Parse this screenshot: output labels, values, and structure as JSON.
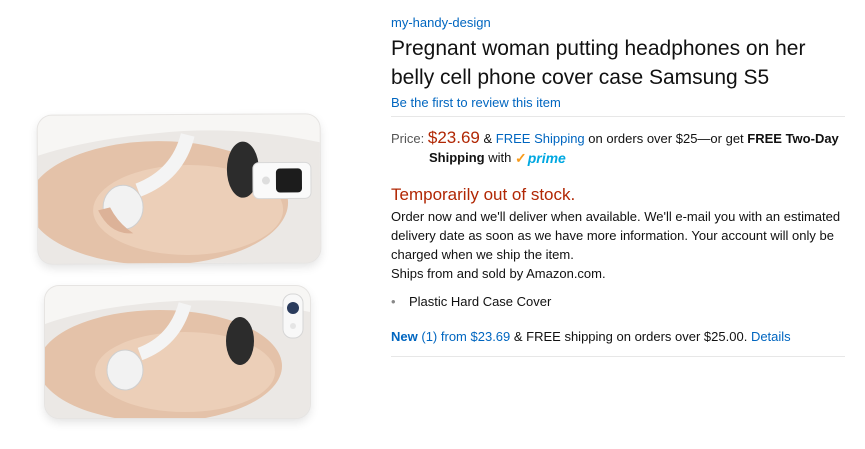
{
  "product": {
    "brand": "my-handy-design",
    "title": "Pregnant woman putting headphones on her belly cell phone cover case Samsung S5",
    "review_link": "Be the first to review this item"
  },
  "price": {
    "label": "Price:",
    "amount": "$23.69",
    "amp": "&",
    "free_shipping_link": "FREE Shipping",
    "orders_text": "on orders over $25—or get",
    "two_day": "FREE Two-Day",
    "shipping": "Shipping",
    "with": "with",
    "prime_check": "✓",
    "prime_word": "prime"
  },
  "availability": {
    "status": "Temporarily out of stock.",
    "message": "Order now and we'll deliver when available. We'll e-mail you with an estimated delivery date as soon as we have more information. Your account will only be charged when we ship the item.",
    "ships_from": "Ships from and sold by Amazon.com."
  },
  "features": [
    "Plastic Hard Case Cover"
  ],
  "offers": {
    "new_label": "New",
    "count": "(1)",
    "from": "from",
    "price": "$23.69",
    "shipping_text": "& FREE shipping on orders over $25.00.",
    "details_link": "Details"
  },
  "colors": {
    "link": "#0066c0",
    "price": "#b12704",
    "prime_blue": "#00a8e1",
    "prime_orange": "#f89b1c"
  }
}
